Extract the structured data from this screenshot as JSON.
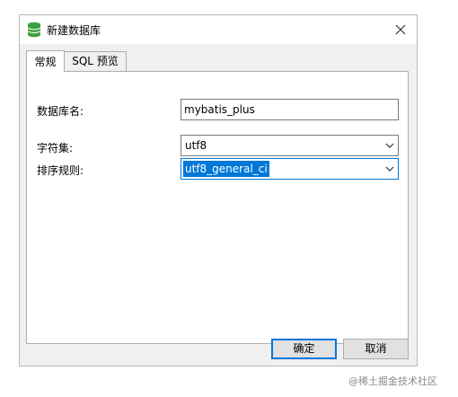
{
  "window": {
    "title": "新建数据库",
    "icon": "database-icon",
    "close_icon": "close-icon"
  },
  "tabs": [
    {
      "label": "常规",
      "active": true
    },
    {
      "label": "SQL 预览",
      "active": false
    }
  ],
  "form": {
    "db_name_label": "数据库名:",
    "db_name_value": "mybatis_plus",
    "charset_label": "字符集:",
    "charset_value": "utf8",
    "collation_label": "排序规则:",
    "collation_value": "utf8_general_ci"
  },
  "buttons": {
    "ok_label": "确定",
    "cancel_label": "取消"
  },
  "watermark": "@稀土掘金技术社区",
  "colors": {
    "accent": "#0078d7",
    "icon_green": "#3aa13e"
  }
}
